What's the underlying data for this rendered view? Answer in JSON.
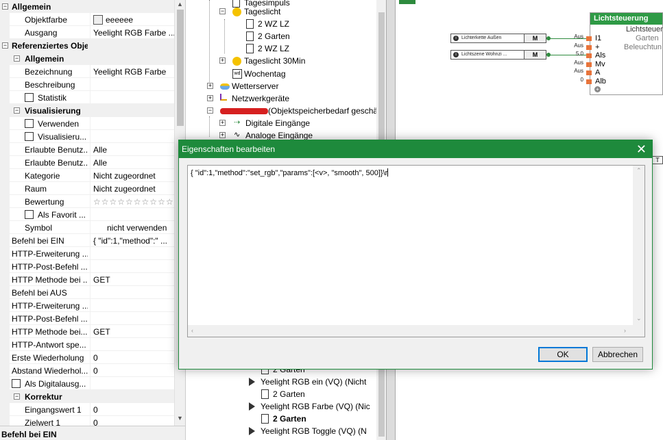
{
  "props": {
    "rows": [
      {
        "kind": "cat",
        "name": "Allgemein",
        "expander": "−"
      },
      {
        "kind": "prop",
        "name": "Objektfarbe",
        "value": "eeeeee",
        "swatch": "#eeeeee"
      },
      {
        "kind": "prop",
        "name": "Ausgang",
        "value": "Yeelight RGB Farbe ..."
      },
      {
        "kind": "cat",
        "name": "Referenziertes Objekt",
        "expander": "−"
      },
      {
        "kind": "sub",
        "name": "Allgemein",
        "expander": "−"
      },
      {
        "kind": "prop",
        "name": "Bezeichnung",
        "value": "Yeelight RGB Farbe"
      },
      {
        "kind": "prop",
        "name": "Beschreibung",
        "value": ""
      },
      {
        "kind": "check",
        "name": "Statistik",
        "value": ""
      },
      {
        "kind": "sub",
        "name": "Visualisierung",
        "expander": "−"
      },
      {
        "kind": "check",
        "name": "Verwenden",
        "value": ""
      },
      {
        "kind": "check",
        "name": "Visualisieru...",
        "value": ""
      },
      {
        "kind": "prop",
        "name": "Erlaubte Benutz...",
        "value": "Alle"
      },
      {
        "kind": "prop",
        "name": "Erlaubte Benutz...",
        "value": "Alle"
      },
      {
        "kind": "prop",
        "name": "Kategorie",
        "value": "Nicht zugeordnet"
      },
      {
        "kind": "prop",
        "name": "Raum",
        "value": "Nicht zugeordnet"
      },
      {
        "kind": "prop",
        "name": "Bewertung",
        "value": "☆☆☆☆☆☆☆☆☆☆",
        "stars": true
      },
      {
        "kind": "check",
        "name": "Als Favorit ...",
        "value": ""
      },
      {
        "kind": "prop",
        "name": "Symbol",
        "value": "nicht verwenden"
      },
      {
        "kind": "top",
        "name": "Befehl bei EIN",
        "value": "{ \"id\":1,\"method\":\" ..."
      },
      {
        "kind": "top",
        "name": "HTTP-Erweiterung ...",
        "value": ""
      },
      {
        "kind": "top",
        "name": "HTTP-Post-Befehl ...",
        "value": ""
      },
      {
        "kind": "top",
        "name": "HTTP Methode bei ...",
        "value": "GET"
      },
      {
        "kind": "top",
        "name": "Befehl bei AUS",
        "value": ""
      },
      {
        "kind": "top",
        "name": "HTTP-Erweiterung ...",
        "value": ""
      },
      {
        "kind": "top",
        "name": "HTTP-Post-Befehl ...",
        "value": ""
      },
      {
        "kind": "top",
        "name": "HTTP Methode bei...",
        "value": "GET"
      },
      {
        "kind": "top",
        "name": "HTTP-Antwort spe...",
        "value": ""
      },
      {
        "kind": "top",
        "name": "Erste Wiederholung",
        "value": "0"
      },
      {
        "kind": "top",
        "name": "Abstand Wiederhol...",
        "value": "0"
      },
      {
        "kind": "topcheck",
        "name": "Als Digitalausg...",
        "value": ""
      },
      {
        "kind": "sub",
        "name": "Korrektur",
        "expander": "−"
      },
      {
        "kind": "prop",
        "name": "Eingangswert 1",
        "value": "0"
      },
      {
        "kind": "prop",
        "name": "Zielwert 1",
        "value": "0"
      }
    ],
    "footer": "Befehl bei EIN"
  },
  "tree": {
    "items": [
      {
        "label": "Tagesimpuls",
        "icon": "page-icon"
      },
      {
        "label": "Tageslicht",
        "icon": "sun-icon",
        "box": "−"
      },
      {
        "label": "2 WZ LZ",
        "icon": "page-icon"
      },
      {
        "label": "2 Garten",
        "icon": "page-icon"
      },
      {
        "label": "2 WZ LZ",
        "icon": "page-icon"
      },
      {
        "label": "Tageslicht 30Min",
        "icon": "sun-icon",
        "box": "+"
      },
      {
        "label": "Wochentag",
        "icon": "weekday-icon"
      },
      {
        "label": "Wetterserver",
        "icon": "weather-icon",
        "box": "+"
      },
      {
        "label": "Netzwerkgeräte",
        "icon": "network-icon",
        "box": "+"
      },
      {
        "label": "(Objektspeicherbedarf geschä",
        "icon": "device-icon",
        "box": "−"
      },
      {
        "label": "Digitale Eingänge",
        "icon": "digital-input-icon",
        "box": "+"
      },
      {
        "label": "Analoge Eingänge",
        "icon": "analog-input-icon",
        "box": "+"
      },
      {
        "label": "2 Garten",
        "icon": "page-icon"
      },
      {
        "label": "Yeelight RGB ein (VQ) (Nicht",
        "icon": "output-icon"
      },
      {
        "label": "2 Garten",
        "icon": "page-icon"
      },
      {
        "label": "Yeelight RGB Farbe (VQ) (Nic",
        "icon": "output-icon"
      },
      {
        "label": "2 Garten",
        "icon": "page-icon",
        "bold": true
      },
      {
        "label": "Yeelight RGB Toggle (VQ) (N",
        "icon": "output-icon"
      }
    ]
  },
  "canvas": {
    "inputs": [
      {
        "label": "Lichterkette Außen",
        "m": "M"
      },
      {
        "label": "Lichtszene Wohnzi ...",
        "m": "M"
      }
    ],
    "block": {
      "title": "Lichtsteuerung",
      "ports": [
        "I1",
        "+",
        "Als",
        "Mv",
        "A",
        "Alb"
      ],
      "port_values": [
        "Aus",
        "Aus",
        "5.0",
        "Aus",
        "Aus",
        "0"
      ],
      "right_lines": [
        "Lichtsteuer",
        "Garten",
        "Beleuchtun"
      ]
    },
    "bubble_label": "T"
  },
  "dialog": {
    "title": "Eigenschaften bearbeiten",
    "close_glyph": "✕",
    "text": "{ \"id\":1,\"method\":\"set_rgb\",\"params\":[<v>, \"smooth\", 500]}\\r",
    "ok_label": "OK",
    "cancel_label": "Abbrechen"
  },
  "colors": {
    "accent": "#1e8a3c",
    "block_header": "#2e9a45",
    "pin": "#e8743b",
    "default_button_border": "#0078d7"
  }
}
